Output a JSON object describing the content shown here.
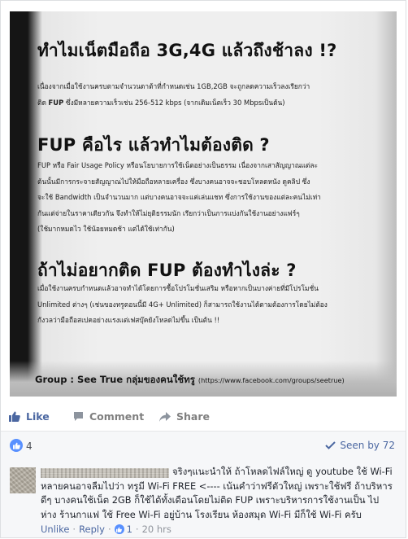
{
  "post_image": {
    "heading1": "ทำไมเน็ตมือถือ 3G,4G แล้วถึงช้าลง !?",
    "para1_line1": "เนื่องจากเมื่อใช้งานครบตามจำนวนดาต้าที่กำหนดเช่น 1GB,2GB จะถูกลดความเร็วลงเรียกว่า",
    "para1_fup": "FUP",
    "para1_line2": "ซึ่งมีหลายความเร็วเช่น 256-512 kbps (จากเดิมเน็ตเร็ว 30 Mbpsเป็นต้น)",
    "heading2": "FUP คือไร แล้วทำไมต้องติด ?",
    "para2_lines": [
      "FUP หรือ Fair Usage Policy หรือนโยบายการใช้เน็ตอย่างเป็นธรรม เนื่องจากเสาสัญญาณแต่ละ",
      "ต้นนั้นมีการกระจายสัญญาณไปให้มือถือหลายเครื่อง ซึ่งบางคนอาจจะชอบโหลดหนัง ดูคลิป ซึ่ง",
      "จะใช้ Bandwidth เป็นจำนวนมาก แต่บางคนอาจจะแค่เล่นแชท ซึ่งการใช้งานของแต่ละคนไม่เท่า",
      "กันแต่จ่ายในราคาเดียวกัน จึงทำให้ไม่ยุติธรรมนัก เรียกว่าเป็นการแบ่งกันใช้งานอย่างแฟร์ๆ",
      "(ใช้มากหมดไว ใช้น้อยหมดช้า แต่ได้ใช้เท่ากัน)"
    ],
    "heading3": "ถ้าไม่อยากติด FUP ต้องทำไงล่ะ ?",
    "para3_lines": [
      "เมื่อใช้งานครบกำหนดแล้วอาจทำได้โดยการซื้อโปรโมชั่นเสริม หรือหากเป็นบางค่ายที่มีโปรโมชั่น",
      "Unlimited ต่างๆ (เช่นของทรูตอนนี้มี 4G+ Unlimited) ก็สามารถใช้งานได้ตามต้องการโดยไม่ต้อง",
      "กังวลว่ามือถือสเปคอย่างแรงแต่เฟสบุ๊คยังโหลดไม่ขึ้น เป็นต้น !!"
    ],
    "group_name": "Group : See True กลุ่มของคนใช้ทรู",
    "group_url": "(https://www.facebook.com/groups/seetrue)"
  },
  "actions": {
    "like_label": "Like",
    "comment_label": "Comment",
    "share_label": "Share"
  },
  "stats": {
    "like_count": "4",
    "seen_by": "Seen by 72"
  },
  "comment": {
    "line1": "จริงๆแนะนำให้ ถ้าโหลดไฟล์ใหญ่ ดู youtube ใช้ Wi-Fi",
    "line2": "หลายคนอาจลืมไปว่า ทรูมี Wi-Fi FREE <---- เน้นคำว่าฟรีตัวใหญ่ เพราะใช้ฟรี ถ้าบริหาร",
    "line3": "ดีๆ บางคนใช้เน็ต 2GB ก็ใช้ได้ทั้งเดือนโดยไม่ติด FUP เพราะบริหารการใช้งานเป็น ไป",
    "line4": "ห่าง ร้านกาแฟ ใช้ Free Wi-Fi อยู่บ้าน โรงเรียน ห้องสมุด Wi-Fi มีก็ใช้ Wi-Fi ครับ",
    "unlike": "Unlike",
    "reply": "Reply",
    "likes": "1",
    "time": "20 hrs"
  },
  "colors": {
    "facebook_blue": "#4b67a1",
    "like_badge": "#5890ff",
    "muted_gray": "#7f7f7f"
  },
  "icons": [
    "thumbs-up-icon",
    "comment-icon",
    "share-arrow-icon",
    "checkmark-icon"
  ]
}
